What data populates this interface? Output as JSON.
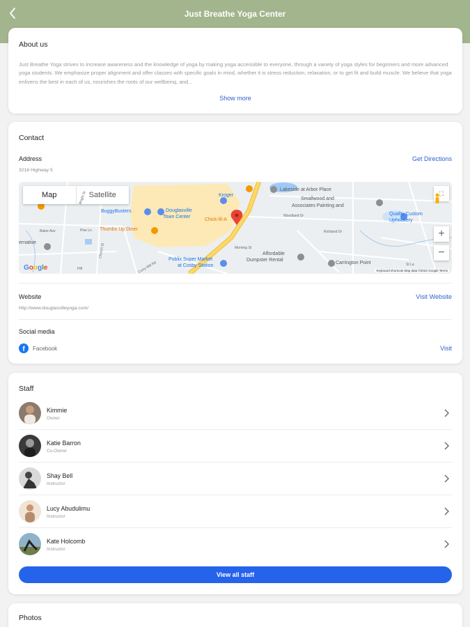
{
  "header": {
    "title": "Just Breathe Yoga Center",
    "back_icon": "chevron-left-icon"
  },
  "about": {
    "title": "About us",
    "description": "Just Breathe Yoga strives to increase awareness and the knowledge of yoga by making yoga accessible to everyone, through a variety of yoga styles for beginners and more advanced yoga students. We emphasize proper alignment and offer classes with specific goals in mind, whether it is stress reduction, relaxation, or to get fit and build muscle. We believe that yoga enlivens the best in each of us, nourishes the roots of our wellbeing, and...",
    "show_more": "Show more"
  },
  "contact": {
    "title": "Contact",
    "address_label": "Address",
    "address": "3216 Highway 5",
    "directions": "Get Directions",
    "map": {
      "tab_map": "Map",
      "tab_satellite": "Satellite",
      "zoom_in": "+",
      "zoom_out": "−",
      "google": "Google",
      "footer": "Keyboard shortcuts   Map data ©2023 Google   Terms",
      "labels": {
        "lakeside": "Lakeside at Arbor Place",
        "smallwood": "Smallwood and",
        "associates": "Associates Painting and",
        "kroger": "Kroger",
        "buggybusters": "BuggyBusters",
        "douglasville1": "Douglasville",
        "douglasville2": "Town Center",
        "quality1": "Quality Custom",
        "quality2": "Upholstery",
        "thumbs": "Thumbs Up Diner",
        "chick": "Chick-fil-A",
        "affordable1": "Affordable",
        "affordable2": "Dumpster Rental",
        "publix1": "Publix Super Market",
        "publix2": "at Cosby Station",
        "carrington": "Carrington Point",
        "native": "ernative",
        "wright": "Bright St",
        "baker": "Baker Ave",
        "pine": "Pine Ln",
        "woodland": "Woodland Dr",
        "richland": "Richland Dr",
        "morning": "Morning St",
        "church": "Church St",
        "cuiry": "Curry Mill Rd",
        "stla": "St La",
        "hill": "Hill"
      }
    },
    "website_label": "Website",
    "website": "http://www.douglasvilleyoga.com/",
    "visit_website": "Visit Website",
    "social_label": "Social media",
    "social_name": "Facebook",
    "visit": "Visit"
  },
  "staff": {
    "title": "Staff",
    "members": [
      {
        "name": "Kimmie",
        "role": "Owner"
      },
      {
        "name": "Katie Barron",
        "role": "Co-Owner"
      },
      {
        "name": "Shay Bell",
        "role": "Instructor"
      },
      {
        "name": "Lucy Abudulimu",
        "role": "Instructor"
      },
      {
        "name": "Kate Holcomb",
        "role": "Instructor"
      }
    ],
    "view_all": "View all staff"
  },
  "photos": {
    "title": "Photos"
  },
  "colors": {
    "header": "#a3b58c",
    "accent": "#2563eb",
    "link": "#2f5fd0"
  }
}
